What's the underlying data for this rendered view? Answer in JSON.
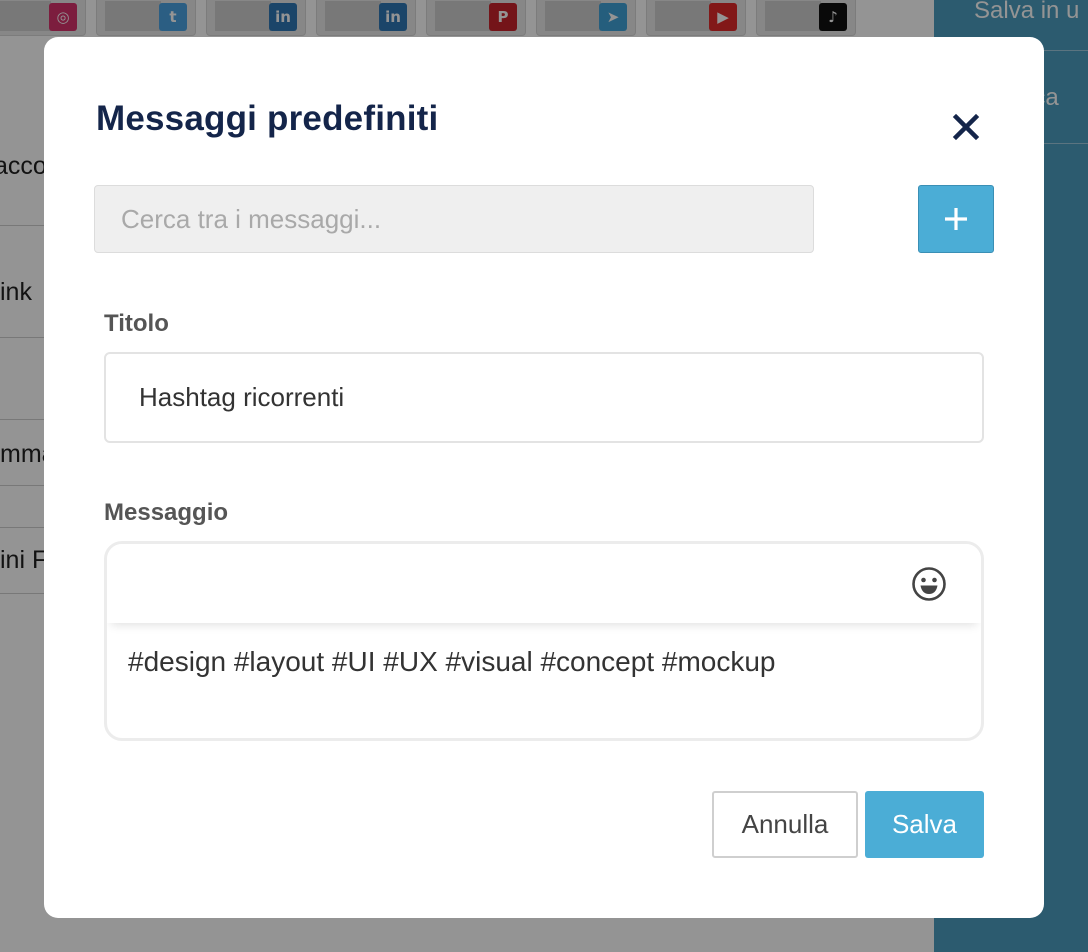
{
  "background": {
    "social_thumbs": [
      {
        "icon": "instagram-icon",
        "glyph": "◎",
        "color": "#d6336c"
      },
      {
        "icon": "twitter-icon",
        "glyph": "t",
        "color": "#4ba3e2"
      },
      {
        "icon": "linkedin-icon",
        "glyph": "in",
        "color": "#2f78b5"
      },
      {
        "icon": "linkedin-icon",
        "glyph": "in",
        "color": "#2f78b5"
      },
      {
        "icon": "pinterest-icon",
        "glyph": "P",
        "color": "#c8232c"
      },
      {
        "icon": "telegram-icon",
        "glyph": "➤",
        "color": "#41a2d8"
      },
      {
        "icon": "youtube-icon",
        "glyph": "▶",
        "color": "#e02a2a"
      },
      {
        "icon": "tiktok-icon",
        "glyph": "♪",
        "color": "#111111"
      }
    ],
    "list_items": [
      "acco",
      "ink",
      "mma",
      "ini F"
    ],
    "right_panel": {
      "save_label": "Salva in u",
      "second_label": "ica"
    }
  },
  "modal": {
    "title": "Messaggi predefiniti",
    "close_icon": "close-icon",
    "search": {
      "placeholder": "Cerca tra i messaggi...",
      "value": ""
    },
    "add_icon": "plus-icon",
    "title_label": "Titolo",
    "title_value": "Hashtag ricorrenti",
    "message_label": "Messaggio",
    "emoji_icon": "emoji-icon",
    "message_text": "#design #layout #UI #UX #visual #concept #mockup",
    "cancel_label": "Annulla",
    "save_label": "Salva"
  },
  "colors": {
    "accent": "#4badd6",
    "title": "#14254a",
    "panel": "#4d9dbf"
  }
}
